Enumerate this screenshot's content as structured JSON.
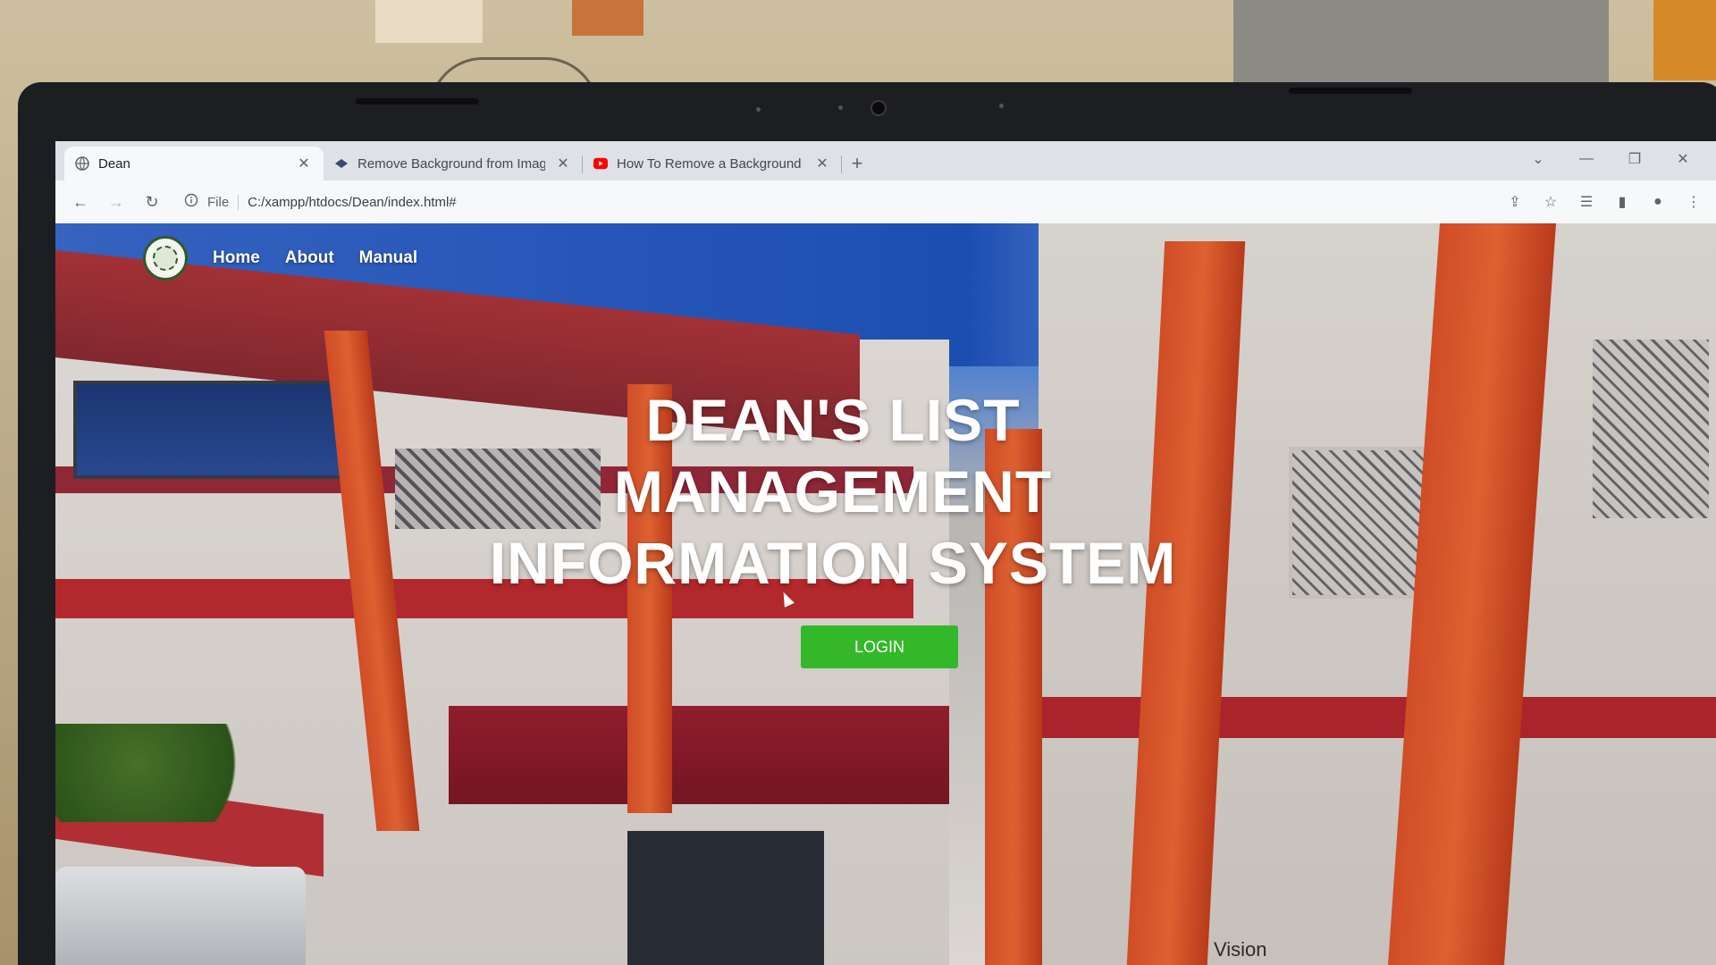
{
  "browser": {
    "tabs": [
      {
        "title": "Dean",
        "favicon": "globe-icon",
        "active": true
      },
      {
        "title": "Remove Background from Imag",
        "favicon": "remove-bg-icon",
        "active": false
      },
      {
        "title": "How To Remove a Background f",
        "favicon": "youtube-icon",
        "active": false
      }
    ],
    "new_tab": "+",
    "address": {
      "file_label": "File",
      "url": "C:/xampp/htdocs/Dean/index.html#"
    }
  },
  "site": {
    "nav": {
      "home": "Home",
      "about": "About",
      "manual": "Manual"
    },
    "hero": {
      "line1": "DEAN'S LIST",
      "line2": "MANAGEMENT",
      "line3": "INFORMATION SYSTEM"
    },
    "login_label": "LOGIN",
    "footer_partial": "Vision"
  },
  "colors": {
    "login_button": "#33b82a",
    "youtube": "#ff0000",
    "tab_strip": "#dee1e6"
  }
}
